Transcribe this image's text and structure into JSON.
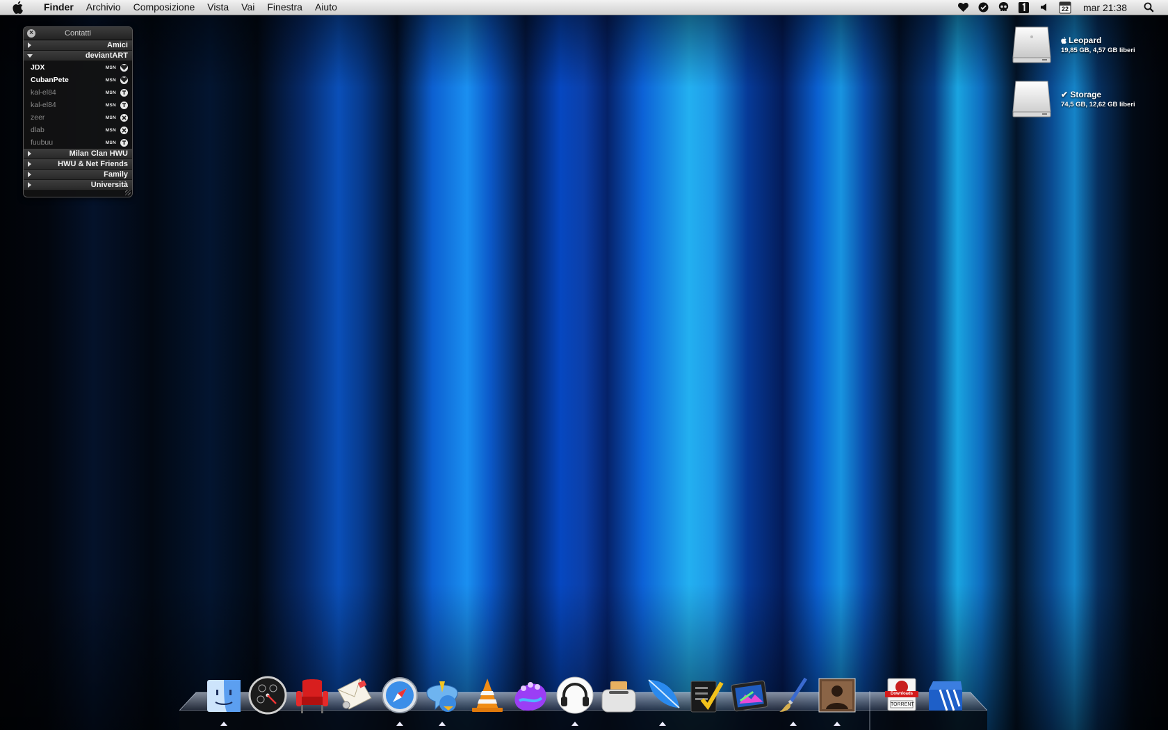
{
  "menubar": {
    "apple_icon": "apple-icon",
    "app_name": "Finder",
    "items": [
      "Archivio",
      "Composizione",
      "Vista",
      "Vai",
      "Finestra",
      "Aiuto"
    ],
    "status_icons": [
      "heart-icon",
      "checkmark-circle-icon",
      "skull-icon",
      "number-one-icon",
      "volume-icon",
      "calendar-icon",
      "spotlight-icon"
    ],
    "calendar_day": "22",
    "clock": "mar 21:38"
  },
  "contacts_widget": {
    "title": "Contatti",
    "groups_top": [
      {
        "label": "Amici",
        "expanded": false
      },
      {
        "label": "deviantART",
        "expanded": true
      }
    ],
    "contacts": [
      {
        "name": "JDX",
        "service": "MSN",
        "status": "online"
      },
      {
        "name": "CubanPete",
        "service": "MSN",
        "status": "online"
      },
      {
        "name": "kal-el84",
        "service": "MSN",
        "status": "offline"
      },
      {
        "name": "kal-el84",
        "service": "MSN",
        "status": "offline"
      },
      {
        "name": "zeer",
        "service": "MSN",
        "status": "offline"
      },
      {
        "name": "dlab",
        "service": "MSN",
        "status": "offline"
      },
      {
        "name": "fuubuu",
        "service": "MSN",
        "status": "offline"
      }
    ],
    "groups_bottom": [
      {
        "label": "Milan Clan HWU",
        "expanded": false
      },
      {
        "label": "HWU & Net Friends",
        "expanded": false
      },
      {
        "label": "Family",
        "expanded": false
      },
      {
        "label": "Università",
        "expanded": false
      }
    ]
  },
  "drives": [
    {
      "name": "Leopard",
      "info": "19,85 GB, 4,57 GB liberi",
      "icon": "hard-drive-icon"
    },
    {
      "name": "✔ Storage",
      "info": "74,5 GB, 12,62 GB liberi",
      "icon": "hard-drive-icon"
    }
  ],
  "dock": {
    "items": [
      {
        "name": "finder",
        "icon": "finder-icon",
        "running": true
      },
      {
        "name": "dashboard",
        "icon": "dashboard-icon",
        "running": false
      },
      {
        "name": "front-row",
        "icon": "front-row-chair-icon",
        "running": false
      },
      {
        "name": "mail",
        "icon": "mail-icon",
        "running": false
      },
      {
        "name": "safari",
        "icon": "safari-compass-icon",
        "running": true
      },
      {
        "name": "adium",
        "icon": "adium-duck-icon",
        "running": true
      },
      {
        "name": "vlc",
        "icon": "vlc-cone-icon",
        "running": false
      },
      {
        "name": "coconut",
        "icon": "purple-wave-icon",
        "running": false
      },
      {
        "name": "itunes",
        "icon": "headphones-icon",
        "running": true
      },
      {
        "name": "toaster",
        "icon": "toaster-icon",
        "running": false
      },
      {
        "name": "feather",
        "icon": "blue-feather-icon",
        "running": true
      },
      {
        "name": "tasks",
        "icon": "checklist-icon",
        "running": false
      },
      {
        "name": "photo-app",
        "icon": "photo-frame-icon",
        "running": false
      },
      {
        "name": "paint",
        "icon": "paintbrush-icon",
        "running": true
      },
      {
        "name": "album",
        "icon": "album-cover-icon",
        "running": true
      },
      {
        "name": "downloads",
        "icon": "downloads-stack-icon",
        "running": false,
        "labels": [
          "Downloads",
          "TORRENT"
        ]
      },
      {
        "name": "trash",
        "icon": "adidas-trash-icon",
        "running": false
      }
    ]
  }
}
